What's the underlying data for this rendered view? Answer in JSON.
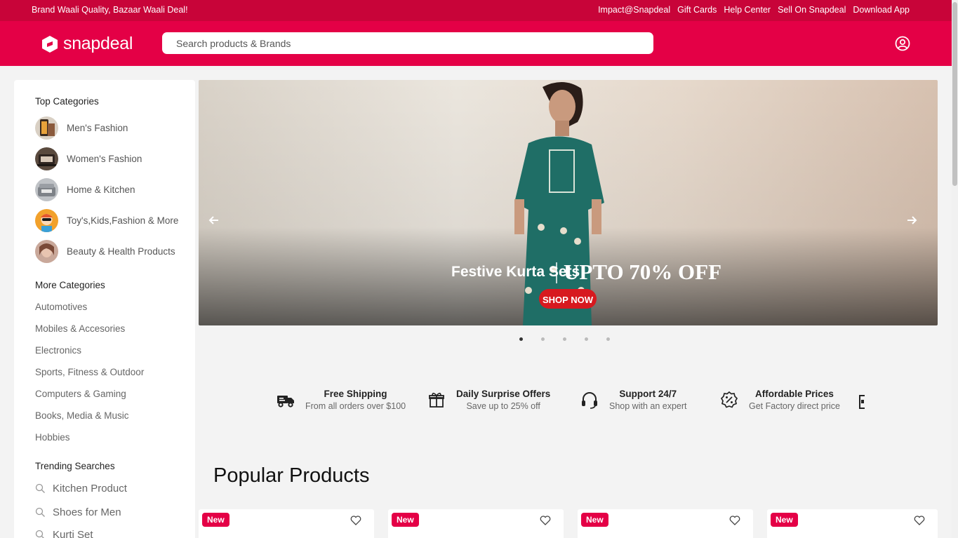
{
  "topbar": {
    "tagline": "Brand Waali Quality, Bazaar Waali Deal!",
    "links": [
      "Impact@Snapdeal",
      "Gift Cards",
      "Help Center",
      "Sell On Snapdeal",
      "Download App"
    ]
  },
  "header": {
    "logo_text": "snapdeal",
    "search_placeholder": "Search products & Brands",
    "brand_color": "#e40046"
  },
  "sidebar": {
    "top_title": "Top Categories",
    "top_categories": [
      "Men's Fashion",
      "Women's Fashion",
      "Home & Kitchen",
      "Toy's,Kids,Fashion & More",
      "Beauty & Health Products"
    ],
    "more_title": "More Categories",
    "more_categories": [
      "Automotives",
      "Mobiles & Accesories",
      "Electronics",
      "Sports, Fitness & Outdoor",
      "Computers & Gaming",
      "Books, Media & Music",
      "Hobbies"
    ],
    "trending_title": "Trending Searches",
    "trending": [
      "Kitchen Product",
      "Shoes for Men",
      "Kurti Set"
    ]
  },
  "banner": {
    "headline": "Festive Kurta Sets",
    "offer": "UPTO 70% OFF",
    "cta": "SHOP NOW",
    "slide_count": 5,
    "active_slide": 1
  },
  "features": [
    {
      "icon": "truck-icon",
      "title": "Free Shipping",
      "subtitle": "From all orders over $100"
    },
    {
      "icon": "gift-icon",
      "title": "Daily Surprise Offers",
      "subtitle": "Save up to 25% off"
    },
    {
      "icon": "headset-icon",
      "title": "Support 24/7",
      "subtitle": "Shop with an expert"
    },
    {
      "icon": "discount-badge-icon",
      "title": "Affordable Prices",
      "subtitle": "Get Factory direct price"
    }
  ],
  "popular": {
    "title": "Popular Products",
    "badge": "New"
  }
}
